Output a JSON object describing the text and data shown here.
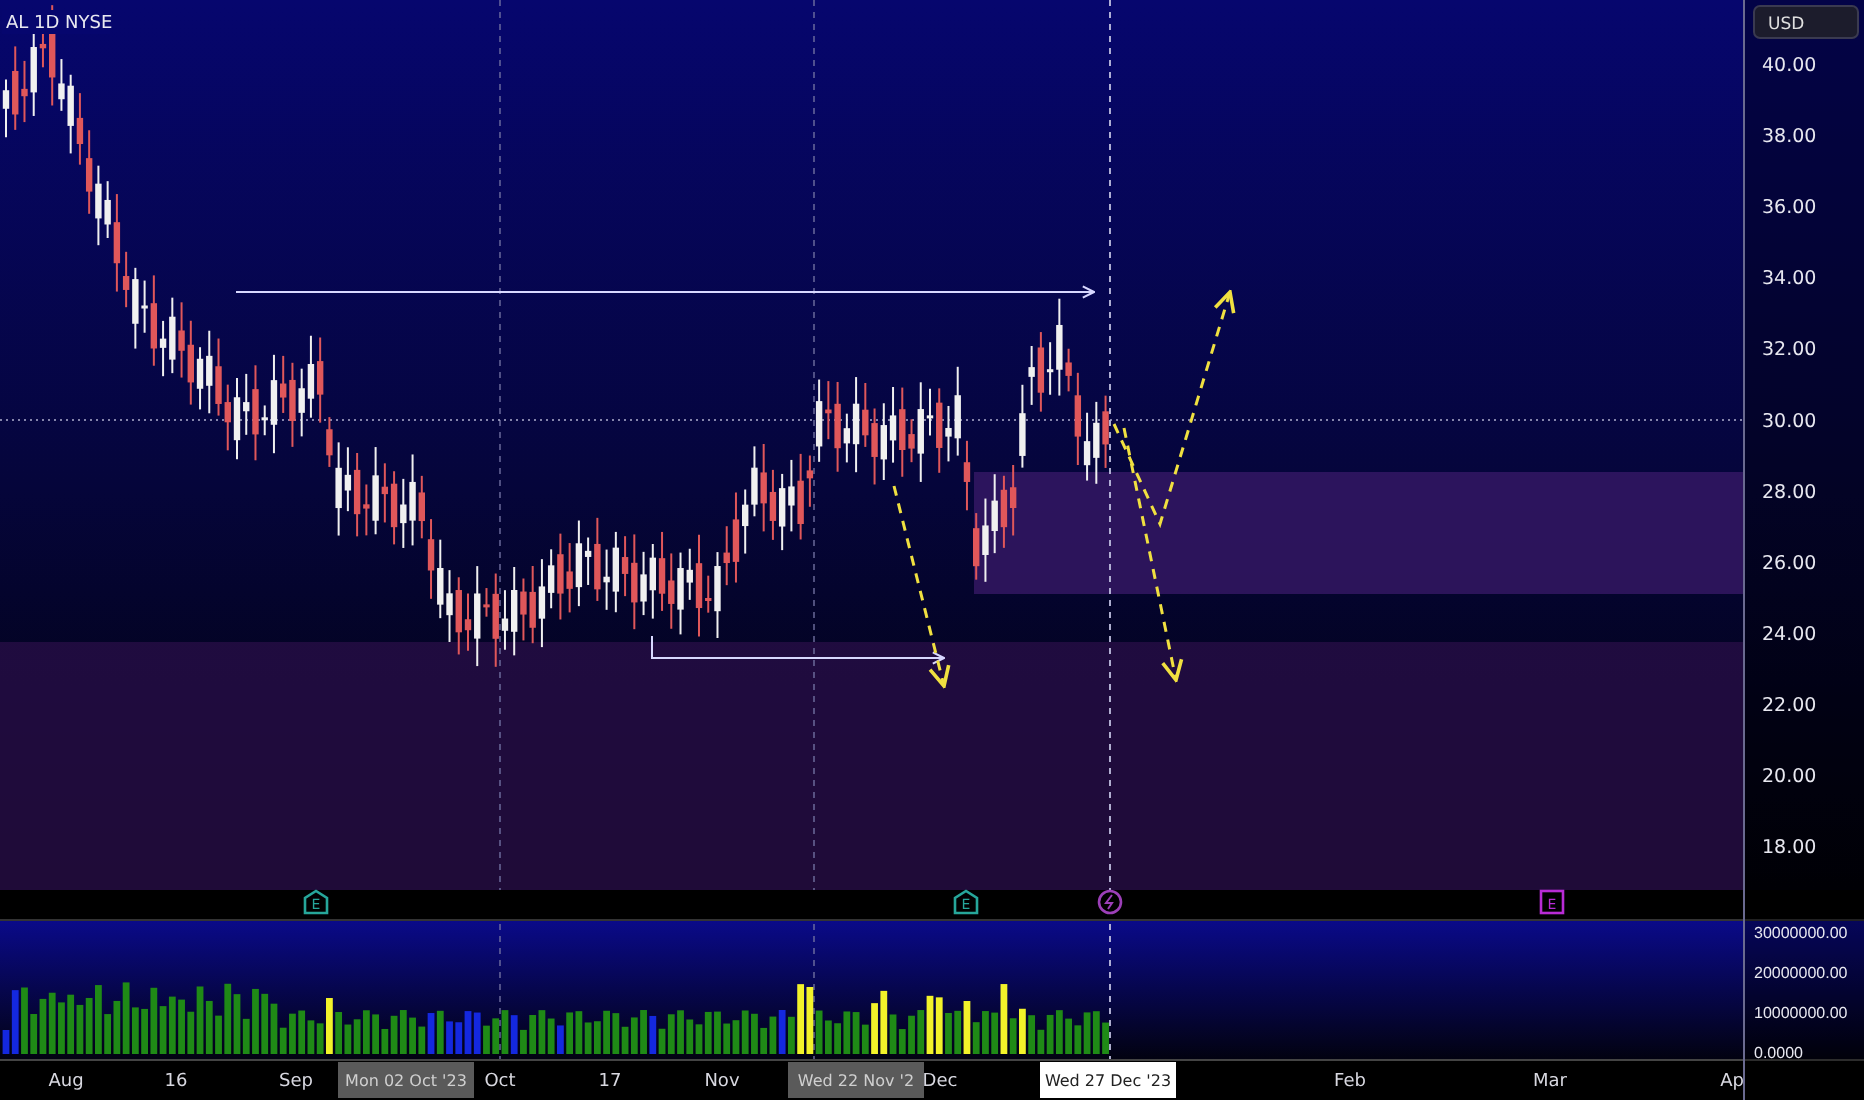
{
  "chart": {
    "symbol": "AL 1D NYSE",
    "currency": "USD",
    "price_ticks": [
      "40.00",
      "38.00",
      "36.00",
      "34.00",
      "32.00",
      "30.00",
      "28.00",
      "26.00",
      "24.00",
      "22.00",
      "20.00",
      "18.00"
    ],
    "volume_ticks": [
      "30000000.00",
      "20000000.00",
      "10000000.00",
      "0.0000"
    ],
    "time_ticks": [
      "Aug",
      "16",
      "Sep",
      "Oct",
      "17",
      "Nov",
      "Dec",
      "Feb",
      "Mar",
      "Ap"
    ],
    "date_markers": [
      {
        "kind": "marker",
        "label": "Mon 02 Oct '23"
      },
      {
        "kind": "marker",
        "label": "Wed 22 Nov '2"
      },
      {
        "kind": "crosshair",
        "label": "Wed 27 Dec '23"
      }
    ],
    "events": [
      {
        "kind": "earnings",
        "label": "E",
        "color": "#26a69a"
      },
      {
        "kind": "earnings",
        "label": "E",
        "color": "#26a69a"
      },
      {
        "kind": "split",
        "color": "#9c3fb8"
      },
      {
        "kind": "earnings",
        "label": "E",
        "color": "#b82bd6"
      }
    ]
  }
}
